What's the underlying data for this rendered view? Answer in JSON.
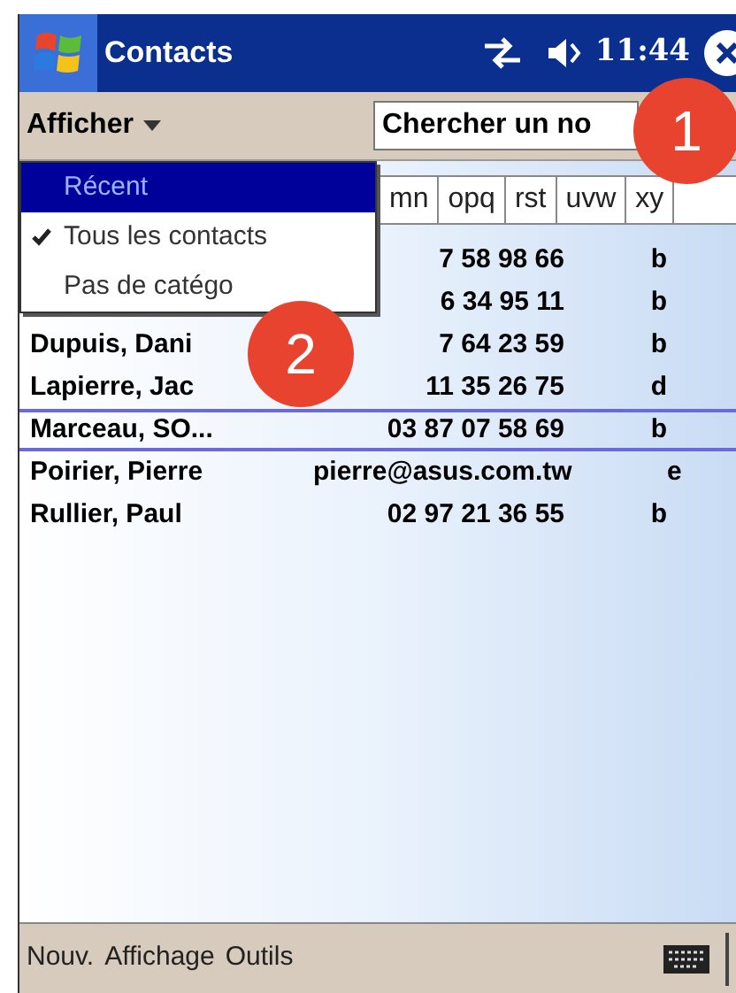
{
  "title_bar": {
    "title": "Contacts",
    "time": "11:44"
  },
  "toolbar": {
    "menu_label": "Afficher",
    "search": {
      "value": "Chercher un no"
    }
  },
  "index_tabs": [
    "mn",
    "opq",
    "rst",
    "uvw",
    "xy"
  ],
  "view_menu": {
    "items": [
      {
        "label": "Récent",
        "selected": true,
        "checked": false
      },
      {
        "label": "Tous les contacts",
        "selected": false,
        "checked": true
      },
      {
        "label": "Pas de catégo",
        "selected": false,
        "checked": false
      }
    ]
  },
  "contacts": [
    {
      "phone": "7 58 98 66",
      "letter": "b",
      "selected": false
    },
    {
      "phone": "6 34 95 11",
      "letter": "b",
      "selected": false
    },
    {
      "name": "Dupuis, Dani",
      "phone": "7 64 23 59",
      "letter": "b",
      "selected": false
    },
    {
      "name": "Lapierre, Jac",
      "phone": "11 35 26 75",
      "letter": "d",
      "selected": false
    },
    {
      "name": "Marceau, SO...",
      "phone": "03 87 07 58 69",
      "letter": "b",
      "selected": true
    },
    {
      "name": "Poirier, Pierre",
      "email": "pierre@asus.com.tw",
      "letter": "e",
      "selected": false
    },
    {
      "name": "Rullier, Paul",
      "phone": "02 97 21 36 55",
      "letter": "b",
      "selected": false
    }
  ],
  "callouts": [
    "1",
    "2"
  ],
  "menu_bar": {
    "items": [
      "Nouv.",
      "Affichage",
      "Outils"
    ]
  }
}
